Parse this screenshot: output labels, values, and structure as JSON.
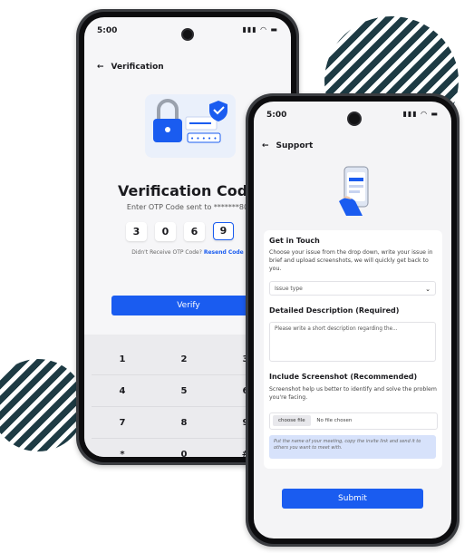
{
  "verification_screen": {
    "status_time": "5:00",
    "status_icons": "▮▮▮ ◠ ▬",
    "back_icon": "←",
    "title": "Verification",
    "heading": "Verification Code",
    "subtitle": "Enter OTP Code sent to *******80",
    "otp_digits": [
      "3",
      "0",
      "6",
      "9"
    ],
    "resend_prefix": "Didn't Receive OTP Code?",
    "resend_link": "Resend Code",
    "verify_label": "Verify",
    "keypad": [
      "1",
      "2",
      "3",
      "4",
      "5",
      "6",
      "7",
      "8",
      "9",
      "*",
      "0",
      "#"
    ]
  },
  "support_screen": {
    "status_time": "5:00",
    "status_icons": "▮▮▮ ◠ ▬",
    "back_icon": "←",
    "title": "Support",
    "card": {
      "heading": "Get in Touch",
      "intro": "Choose your issue from the drop down, write your issue in brief and upload screenshots, we will quickly get back to you.",
      "issue_placeholder": "Issue type",
      "description_heading": "Detailed Description (Required)",
      "description_placeholder": "Please write a short description regarding the...",
      "screenshot_heading": "Include Screenshot (Recommended)",
      "screenshot_help": "Screenshot help us better to identify and solve the problem you're facing.",
      "choose_file_label": "choose file",
      "file_status": "No file chosen",
      "hint": "Put the name of your meeting, copy the invite link and send it to others you want to meet with."
    },
    "submit_label": "Submit"
  },
  "colors": {
    "accent": "#1a5cf0",
    "stripe": "#1e3b44",
    "hint_bg": "#d7e2fb"
  }
}
